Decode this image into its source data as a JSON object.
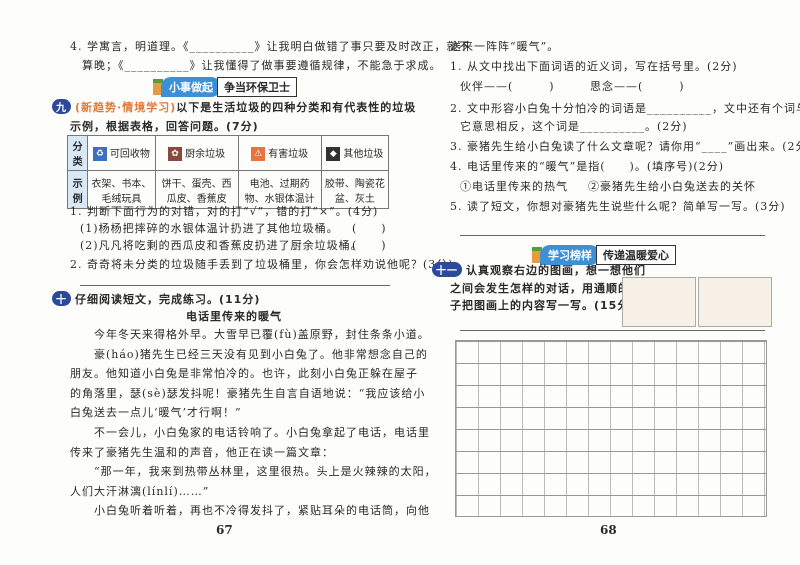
{
  "left": {
    "q4_line1": "4. 学寓言，明道理。《__________》让我明白做错了事只要及时改正，就不",
    "q4_line2": "算晚；《__________》让我懂得了做事要遵循规律，不能急于求成。",
    "badge": {
      "left": "小事做起",
      "right": "争当环保卫士"
    },
    "s9": {
      "num": "九",
      "tag": "(新趋势·情境学习)",
      "text": "以下是生活垃圾的四种分类和有代表性的垃圾",
      "line2": "示例，根据表格，回答问题。(7分)"
    },
    "table": {
      "row1_label": "分类",
      "row2_label": "示例",
      "categories": [
        {
          "name": "可回收物",
          "color": "#3a6fc2",
          "example": "衣架、书本、毛绒玩具"
        },
        {
          "name": "厨余垃圾",
          "color": "#8a4a3a",
          "example": "饼干、蛋壳、西瓜皮、香蕉皮"
        },
        {
          "name": "有害垃圾",
          "color": "#e8743a",
          "example": "电池、过期药物、水银体温计"
        },
        {
          "name": "其他垃圾",
          "color": "#333333",
          "example": "胶带、陶瓷花盆、灰土"
        }
      ]
    },
    "q1": "1. 判断下面行为的对错，对的打“√”，错的打“×”。(4分)",
    "q1a": "(1)杨杨把摔碎的水银体温计扔进了其他垃圾桶。",
    "q1b": "(2)凡凡将吃剩的西瓜皮和香蕉皮扔进了厨余垃圾桶。",
    "paren": "(　　)",
    "q2": "2. 奇奇将未分类的垃圾随手丢到了垃圾桶里，你会怎样劝说他呢？(3分)",
    "s10": {
      "num": "十",
      "text": "仔细阅读短文，完成练习。(11分)"
    },
    "story_title": "电话里传来的暖气",
    "story": [
      "　　今年冬天来得格外早。大雪早已覆(fù)盖原野，封住条条小道。",
      "　　豪(háo)猪先生已经三天没有见到小白兔了。他非常想念自己的",
      "朋友。他知道小白兔是非常怕冷的。也许，此刻小白兔正躲在屋子",
      "的角落里，瑟(sè)瑟发抖呢！豪猪先生自言自语地说：“我应该给小",
      "白兔送去一点儿‘暖气’才行啊！”",
      "　　不一会儿，小白兔家的电话铃响了。小白兔拿起了电话，电话里",
      "传来了豪猪先生温和的声音，他正在读一篇文章：",
      "　　“那一年，我来到热带丛林里，这里很热。头上是火辣辣的太阳，",
      "人们大汗淋漓(línlí)……”",
      "　　小白兔听着听着，再也不冷得发抖了，紧贴耳朵的电话筒，向他"
    ],
    "page": "67"
  },
  "right": {
    "l0": "送来一阵阵“暖气”。",
    "q1": "1. 从文中找出下面词语的近义词，写在括号里。(2分)",
    "q1a": "伙伴——(　　　)",
    "q1b": "思念——(　　　)",
    "q2a": "2. 文中形容小白兔十分怕冷的词语是__________，文中还有个词与",
    "q2b": "它意思相反，这个词是__________。(2分)",
    "q3": "3. 豪猪先生给小白兔读了什么文章呢？请你用“____”画出来。(2分)",
    "q4": "4. 电话里传来的“暖气”是指(　　)。(填序号)(2分)",
    "q4a": "①电话里传来的热气",
    "q4b": "②豪猪先生给小白兔送去的关怀",
    "q5": "5. 读了短文，你想对豪猪先生说些什么呢？简单写一写。(3分)",
    "badge": {
      "left": "学习榜样",
      "right": "传递温暖爱心"
    },
    "s11": {
      "num": "十一",
      "l1": "认真观察右边的图画，想一想他们",
      "l2": "之间会发生怎样的对话，用通顺的句",
      "l3": "子把图画上的内容写一写。(15分)"
    },
    "page": "68"
  }
}
